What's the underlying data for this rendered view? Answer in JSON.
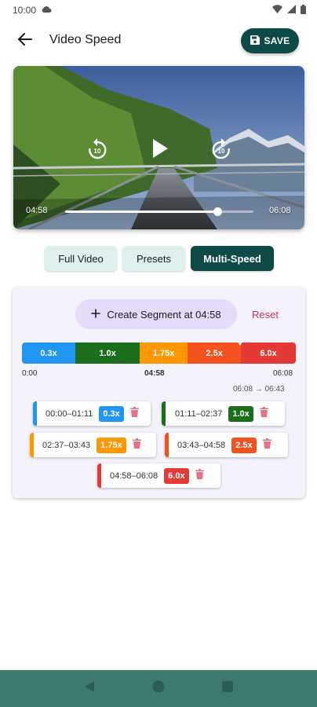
{
  "status_bar": {
    "time": "10:00",
    "icons": [
      "cloud-icon",
      "wifi-icon",
      "signal-icon",
      "battery-icon"
    ]
  },
  "app_bar": {
    "title": "Video Speed",
    "save_label": "SAVE",
    "back_icon": "arrow-left-icon",
    "save_icon": "floppy-disk-icon"
  },
  "player": {
    "current_time": "04:58",
    "duration": "06:08",
    "progress": 0.81,
    "controls": [
      "rewind-10-icon",
      "play-icon",
      "forward-10-icon"
    ]
  },
  "mode_tabs": [
    {
      "label": "Full Video",
      "active": false
    },
    {
      "label": "Presets",
      "active": false
    },
    {
      "label": "Multi-Speed",
      "active": true
    }
  ],
  "segments_panel": {
    "create_label": "Create Segment at 04:58",
    "reset_label": "Reset",
    "timeline_start": "0:00",
    "timeline_marker": "04:58",
    "timeline_end": "06:08",
    "duration_change": "06:08 → 06:43",
    "speed_bar": [
      {
        "label": "0.3x",
        "color": "#2196f3",
        "fraction": 0.195
      },
      {
        "label": "1.0x",
        "color": "#1b6e1b",
        "fraction": 0.235
      },
      {
        "label": "1.75x",
        "color": "#ff9800",
        "fraction": 0.175
      },
      {
        "label": "2.5x",
        "color": "#f4511e",
        "fraction": 0.195
      },
      {
        "label": "6.0x",
        "color": "#e53935",
        "fraction": 0.2
      }
    ],
    "segments": [
      {
        "range": "00:00–01:11",
        "speed": "0.3x",
        "color": "#2196f3"
      },
      {
        "range": "01:11–02:37",
        "speed": "1.0x",
        "color": "#1b6e1b"
      },
      {
        "range": "02:37–03:43",
        "speed": "1.75x",
        "color": "#ff9800"
      },
      {
        "range": "03:43–04:58",
        "speed": "2.5x",
        "color": "#f4511e"
      },
      {
        "range": "04:58–06:08",
        "speed": "6.0x",
        "color": "#e53935"
      }
    ]
  },
  "nav_bar": {
    "icons": [
      "back-triangle-icon",
      "home-circle-icon",
      "recents-square-icon"
    ]
  }
}
